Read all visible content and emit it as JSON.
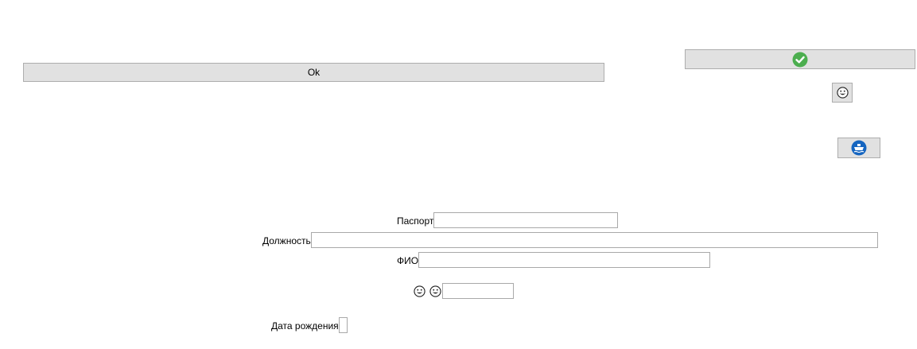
{
  "buttons": {
    "ok_label": "Ok"
  },
  "fields": {
    "passport_label": "Паспорт",
    "position_label": "Должность",
    "fullname_label": "ФИО",
    "birthdate_label": "Дата рождения",
    "passport_value": "",
    "position_value": "",
    "fullname_value": "",
    "emoji_field_value": "",
    "birthdate_value": ""
  },
  "icons": {
    "confirm": "green-checkmark-icon",
    "emoji_button": "grinning-face-icon",
    "ship_button": "blue-ship-icon",
    "emoji_1": "grinning-face-icon",
    "emoji_2": "grinning-face-icon"
  },
  "colors": {
    "button_bg": "#e1e1e1",
    "button_border": "#adadad",
    "check_green": "#4cae4f",
    "ship_blue": "#1565c0"
  }
}
